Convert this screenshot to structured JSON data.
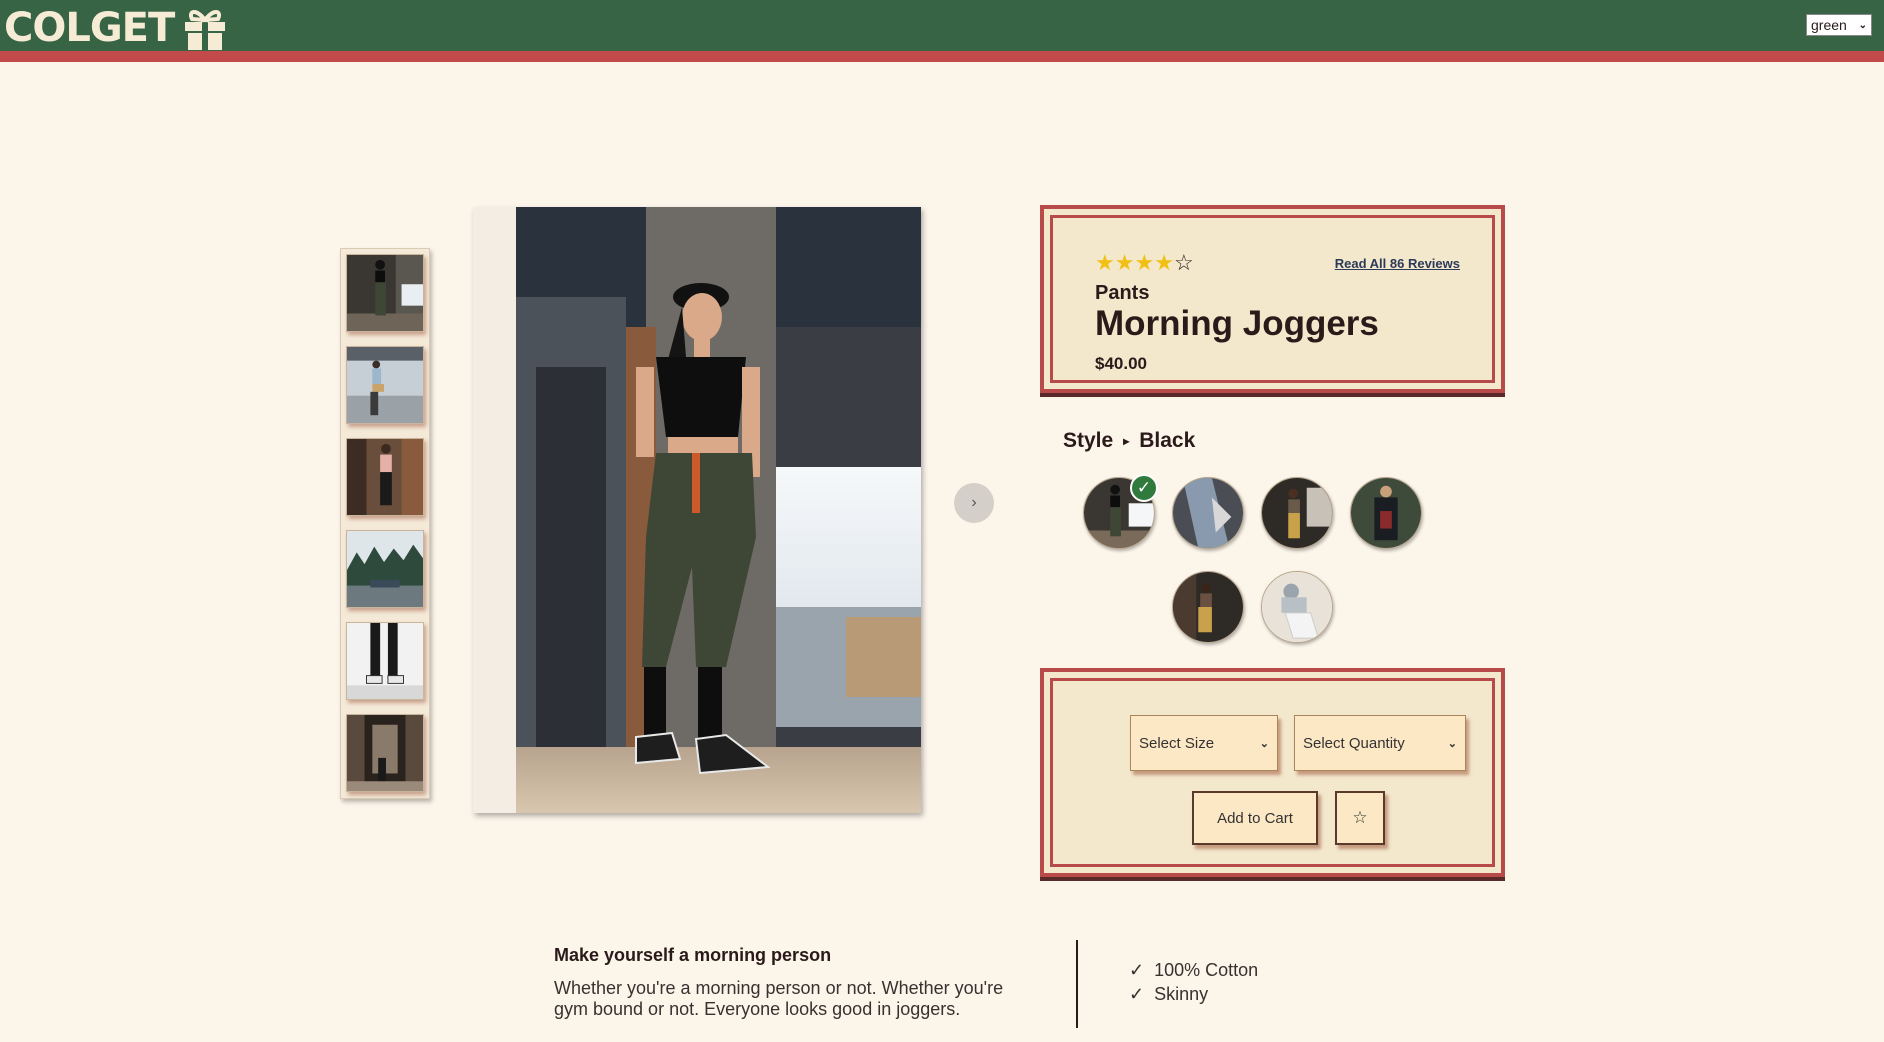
{
  "header": {
    "logo_text": "COLGET",
    "logo_icon": "gift-icon",
    "theme_value": "green",
    "brand_color": "#376444",
    "accent_color": "#c24a4a"
  },
  "gallery": {
    "thumbnail_count": 6,
    "next_label": "›"
  },
  "product": {
    "rating": 4,
    "rating_max": 5,
    "stars": [
      "★",
      "★",
      "★",
      "★",
      "☆"
    ],
    "reviews_link": "Read All 86 Reviews",
    "category": "Pants",
    "name": "Morning Joggers",
    "price": "$40.00"
  },
  "style": {
    "label": "Style",
    "arrow": "▸",
    "selected": "Black",
    "check": "✓",
    "swatch_count": 6
  },
  "cart": {
    "size_placeholder": "Select Size",
    "quantity_placeholder": "Select Quantity",
    "add_label": "Add to Cart",
    "favorite_label": "☆"
  },
  "description": {
    "title": "Make yourself a morning person",
    "body": "Whether you're a morning person or not. Whether you're gym bound or not. Everyone looks good in joggers.",
    "features": [
      {
        "check": "✓",
        "text": "100% Cotton"
      },
      {
        "check": "✓",
        "text": "Skinny"
      }
    ]
  }
}
